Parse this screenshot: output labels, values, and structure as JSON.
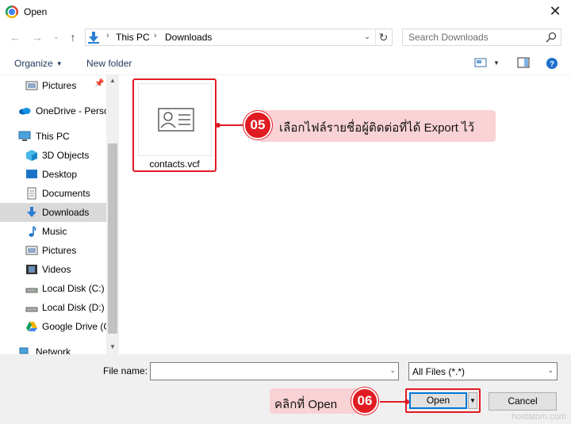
{
  "window": {
    "title": "Open",
    "close_glyph": "✕"
  },
  "nav": {
    "back": "←",
    "forward": "→",
    "recent": "⌄",
    "up": "↑"
  },
  "address": {
    "crumbs": [
      "This PC",
      "Downloads"
    ],
    "separator": "›",
    "dropdown": "⌄",
    "refresh": "↻"
  },
  "search": {
    "placeholder": "Search Downloads"
  },
  "toolbar": {
    "organize_label": "Organize",
    "new_folder_label": "New folder"
  },
  "sidebar": {
    "items": [
      {
        "label": "Pictures",
        "icon": "pictures-icon"
      },
      {
        "label": "OneDrive - Perso",
        "icon": "onedrive-icon"
      },
      {
        "label": "This PC",
        "icon": "pc-icon"
      },
      {
        "label": "3D Objects",
        "icon": "3d-objects-icon"
      },
      {
        "label": "Desktop",
        "icon": "desktop-icon"
      },
      {
        "label": "Documents",
        "icon": "documents-icon"
      },
      {
        "label": "Downloads",
        "icon": "downloads-icon"
      },
      {
        "label": "Music",
        "icon": "music-icon"
      },
      {
        "label": "Pictures",
        "icon": "pictures-icon"
      },
      {
        "label": "Videos",
        "icon": "videos-icon"
      },
      {
        "label": "Local Disk (C:)",
        "icon": "disk-icon"
      },
      {
        "label": "Local Disk (D:)",
        "icon": "disk-icon"
      },
      {
        "label": "Google Drive (G",
        "icon": "google-drive-icon"
      },
      {
        "label": "Network",
        "icon": "network-icon"
      }
    ],
    "selected": "Downloads"
  },
  "files": [
    {
      "name": "contacts.vcf",
      "icon": "contact-card-icon"
    }
  ],
  "bottom": {
    "file_name_label": "File name:",
    "file_name_value": "",
    "file_type": "All Files (*.*)",
    "open_label": "Open",
    "cancel_label": "Cancel"
  },
  "annotations": {
    "step5_number": "05",
    "step5_text": "เลือกไฟล์รายชื่อผู้ติดต่อที่ได้ Export ไว้",
    "step6_number": "06",
    "step6_text": "คลิกที่ Open",
    "accent_color": "#e11b22",
    "callout_bg": "#f9d2d6"
  },
  "watermark": "hostatom.com"
}
